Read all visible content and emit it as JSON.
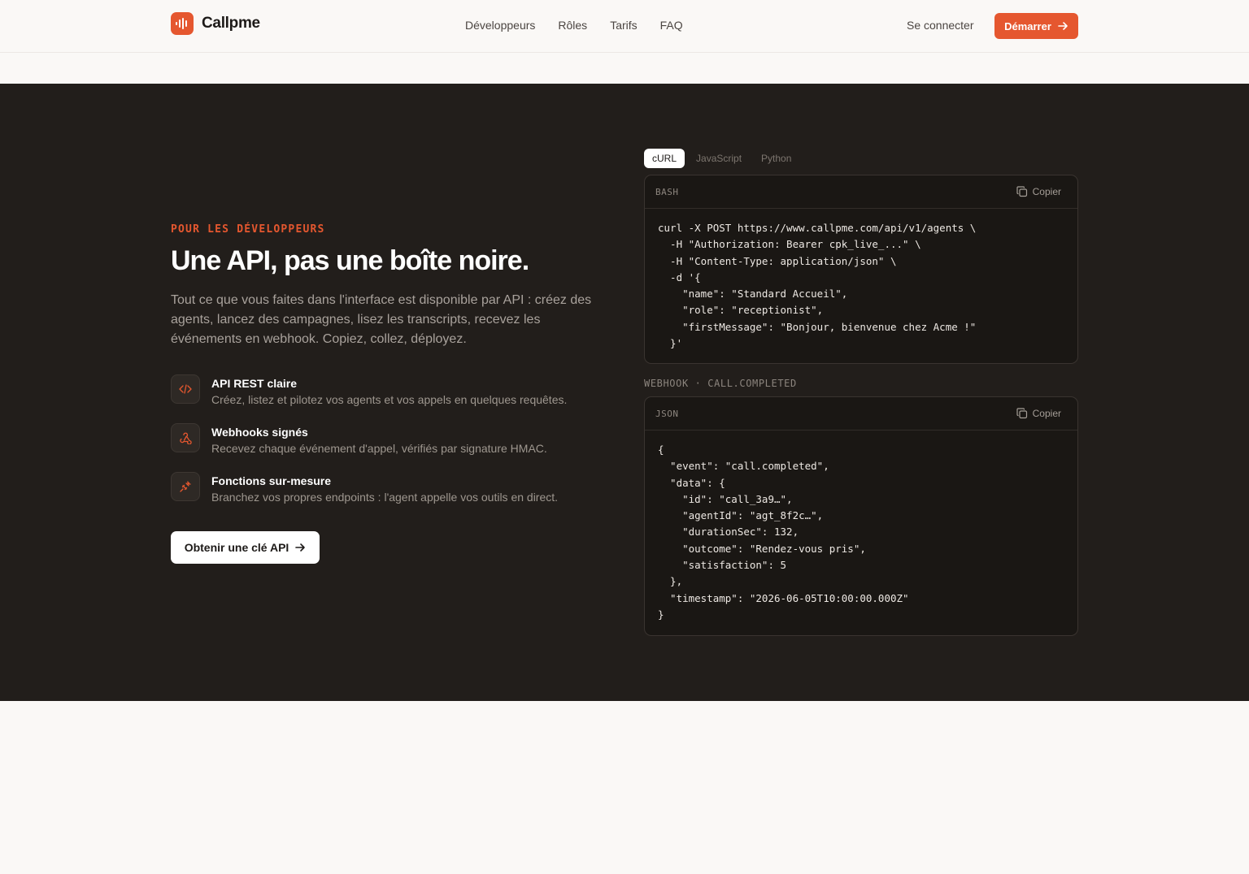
{
  "brand": {
    "name": "Callpme",
    "accent": "#e5572f"
  },
  "nav": {
    "items": [
      "Développeurs",
      "Rôles",
      "Tarifs",
      "FAQ"
    ],
    "signin": "Se connecter",
    "start": "Démarrer"
  },
  "hero": {
    "eyebrow": "POUR LES DÉVELOPPEURS",
    "title": "Une API, pas une boîte noire.",
    "lead": "Tout ce que vous faites dans l'interface est disponible par API : créez des agents, lancez des campagnes, lisez les transcripts, recevez les événements en webhook. Copiez, collez, déployez.",
    "features": [
      {
        "icon": "code-icon",
        "title": "API REST claire",
        "desc": "Créez, listez et pilotez vos agents et vos appels en quelques requêtes."
      },
      {
        "icon": "webhook-icon",
        "title": "Webhooks signés",
        "desc": "Recevez chaque événement d'appel, vérifiés par signature HMAC."
      },
      {
        "icon": "plug-icon",
        "title": "Fonctions sur-mesure",
        "desc": "Branchez vos propres endpoints : l'agent appelle vos outils en direct."
      }
    ],
    "cta": "Obtenir une clé API"
  },
  "code": {
    "tabs": [
      "cURL",
      "JavaScript",
      "Python"
    ],
    "active_tab": "cURL",
    "request": {
      "lang": "BASH",
      "copy": "Copier",
      "body": "curl -X POST https://www.callpme.com/api/v1/agents \\\n  -H \"Authorization: Bearer cpk_live_...\" \\\n  -H \"Content-Type: application/json\" \\\n  -d '{\n    \"name\": \"Standard Accueil\",\n    \"role\": \"receptionist\",\n    \"firstMessage\": \"Bonjour, bienvenue chez Acme !\"\n  }'"
    },
    "webhook_label": "WEBHOOK · CALL.COMPLETED",
    "webhook": {
      "lang": "JSON",
      "copy": "Copier",
      "body": "{\n  \"event\": \"call.completed\",\n  \"data\": {\n    \"id\": \"call_3a9…\",\n    \"agentId\": \"agt_8f2c…\",\n    \"durationSec\": 132,\n    \"outcome\": \"Rendez-vous pris\",\n    \"satisfaction\": 5\n  },\n  \"timestamp\": \"2026-06-05T10:00:00.000Z\"\n}"
    }
  }
}
